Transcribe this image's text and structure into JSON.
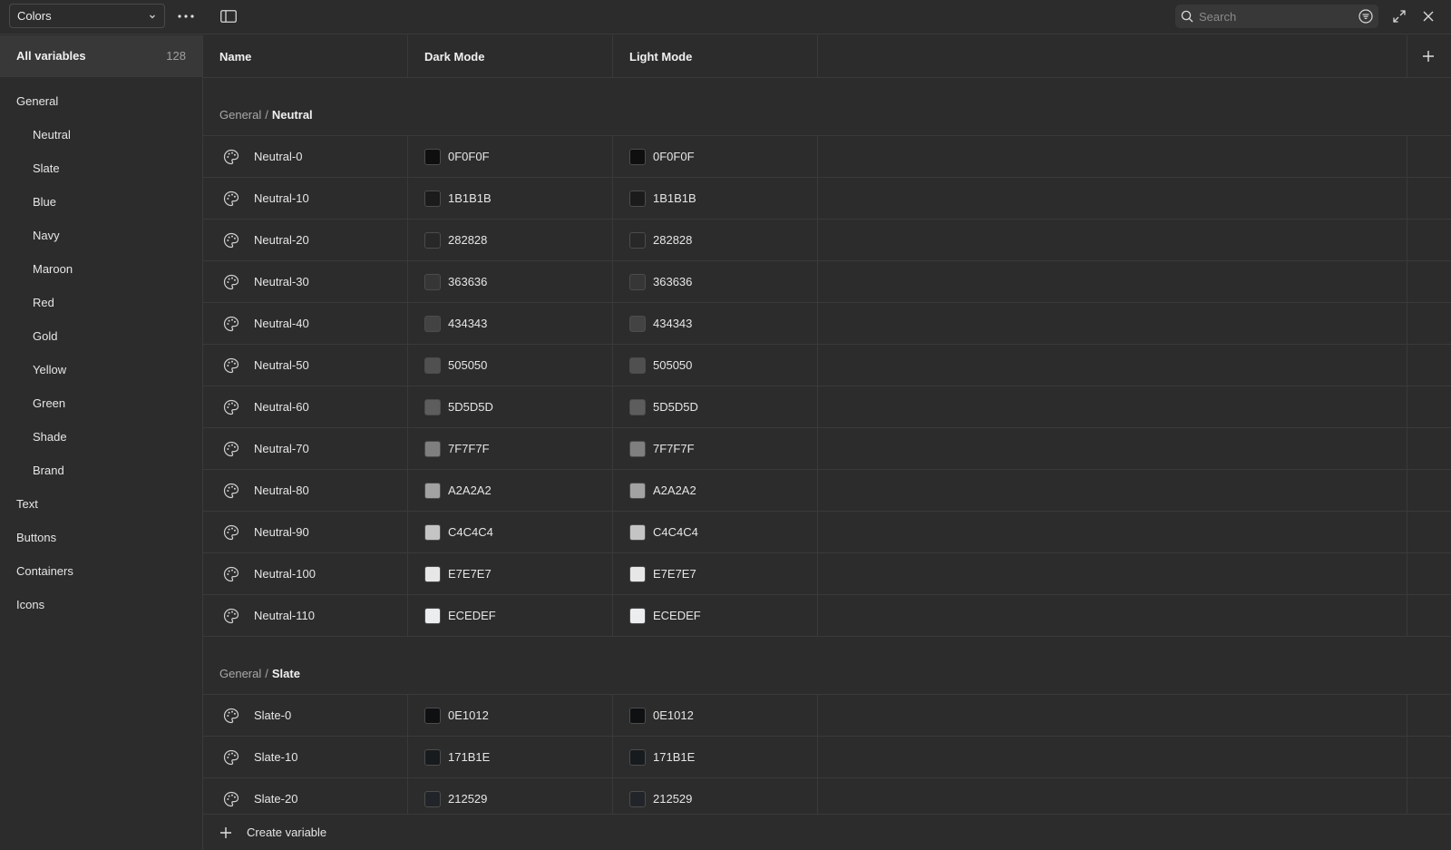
{
  "toolbar": {
    "collection": "Colors",
    "search_placeholder": "Search"
  },
  "sidebar": {
    "all": {
      "label": "All variables",
      "count": "128"
    },
    "groups": [
      {
        "label": "General"
      },
      {
        "label": "Neutral"
      },
      {
        "label": "Slate"
      },
      {
        "label": "Blue"
      },
      {
        "label": "Navy"
      },
      {
        "label": "Maroon"
      },
      {
        "label": "Red"
      },
      {
        "label": "Gold"
      },
      {
        "label": "Yellow"
      },
      {
        "label": "Green"
      },
      {
        "label": "Shade"
      },
      {
        "label": "Brand"
      },
      {
        "label": "Text"
      },
      {
        "label": "Buttons"
      },
      {
        "label": "Containers"
      },
      {
        "label": "Icons"
      }
    ]
  },
  "table": {
    "headers": {
      "name": "Name",
      "dark": "Dark Mode",
      "light": "Light Mode"
    },
    "groups": [
      {
        "parent": "General",
        "separator": "/",
        "name": "Neutral",
        "rows": [
          {
            "name": "Neutral-0",
            "dark": "0F0F0F",
            "light": "0F0F0F"
          },
          {
            "name": "Neutral-10",
            "dark": "1B1B1B",
            "light": "1B1B1B"
          },
          {
            "name": "Neutral-20",
            "dark": "282828",
            "light": "282828"
          },
          {
            "name": "Neutral-30",
            "dark": "363636",
            "light": "363636"
          },
          {
            "name": "Neutral-40",
            "dark": "434343",
            "light": "434343"
          },
          {
            "name": "Neutral-50",
            "dark": "505050",
            "light": "505050"
          },
          {
            "name": "Neutral-60",
            "dark": "5D5D5D",
            "light": "5D5D5D"
          },
          {
            "name": "Neutral-70",
            "dark": "7F7F7F",
            "light": "7F7F7F"
          },
          {
            "name": "Neutral-80",
            "dark": "A2A2A2",
            "light": "A2A2A2"
          },
          {
            "name": "Neutral-90",
            "dark": "C4C4C4",
            "light": "C4C4C4"
          },
          {
            "name": "Neutral-100",
            "dark": "E7E7E7",
            "light": "E7E7E7"
          },
          {
            "name": "Neutral-110",
            "dark": "ECEDEF",
            "light": "ECEDEF"
          }
        ]
      },
      {
        "parent": "General",
        "separator": "/",
        "name": "Slate",
        "rows": [
          {
            "name": "Slate-0",
            "dark": "0E1012",
            "light": "0E1012"
          },
          {
            "name": "Slate-10",
            "dark": "171B1E",
            "light": "171B1E"
          },
          {
            "name": "Slate-20",
            "dark": "212529",
            "light": "212529"
          }
        ]
      }
    ]
  },
  "footer": {
    "create_label": "Create variable"
  },
  "theme": {
    "background": "#2c2c2c",
    "border": "#3a3a3a",
    "selected": "#383838"
  }
}
